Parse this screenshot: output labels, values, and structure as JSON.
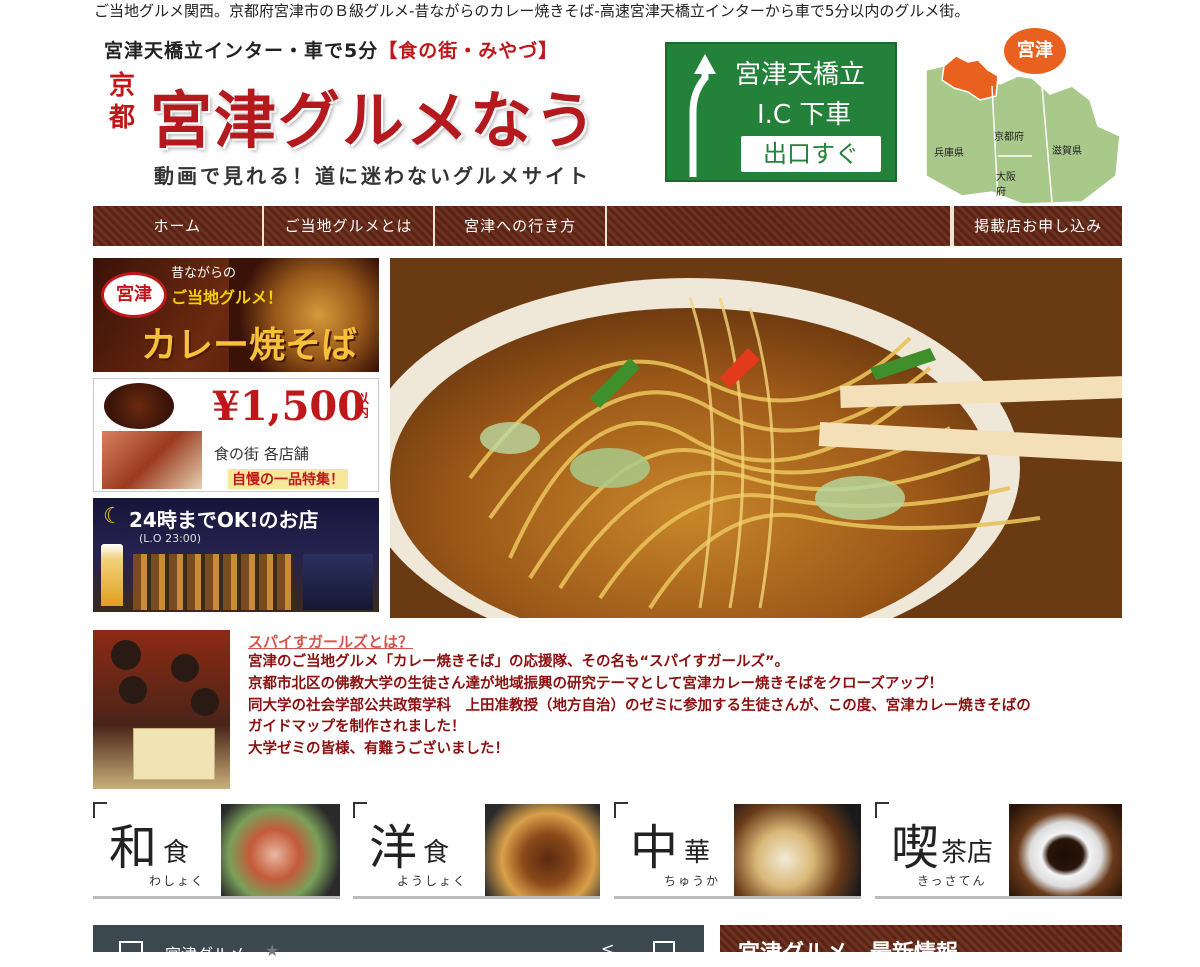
{
  "tagline": "ご当地グルメ関西。京都府宮津市のＢ級グルメ-昔ながらのカレー焼きそば-高速宮津天橋立インターから車で5分以内のグルメ街。",
  "header": {
    "top_line": "宮津天橋立インター・車で5分",
    "top_line_red": "【食の街・みやづ】",
    "kyoto": "京都",
    "title": "宮津グルメなう",
    "subtitle": "動画で見れる！道に迷わないグルメサイト"
  },
  "sign": {
    "line1": "宮津天橋立",
    "line2": "I.C 下車",
    "exit": "出口すぐ"
  },
  "map": {
    "badge": "宮津",
    "labels": [
      "兵庫県",
      "京都府",
      "滋賀県",
      "大阪府"
    ]
  },
  "nav": {
    "items": [
      "ホーム",
      "ご当地グルメとは",
      "宮津への行き方",
      "",
      "掲載店お申し込み"
    ]
  },
  "banners": {
    "b1": {
      "tag": "宮津",
      "l1": "昔ながらの",
      "l2": "ご当地グルメ！",
      "l3": "カレー焼そば"
    },
    "b2": {
      "price": "¥1,500",
      "suffix": "以内",
      "l1": "食の街 各店舗",
      "l2": "自慢の一品特集！"
    },
    "b3": {
      "l1": "24時までOK!のお店",
      "l2": "(L.O 23:00)"
    }
  },
  "spicy": {
    "link": "スパイすガールズとは？",
    "lines": [
      "宮津のご当地グルメ「カレー焼きそば」の応援隊、その名も“スパイすガールズ”。",
      "京都市北区の佛教大学の生徒さん達が地域振興の研究テーマとして宮津カレー焼きそばをクローズアップ！",
      "同大学の社会学部公共政策学科　上田准教授（地方自治）のゼミに参加する生徒さんが、この度、宮津カレー焼きそばの",
      "ガイドマップを制作されました！",
      "大学ゼミの皆様、有難うございました！"
    ]
  },
  "categories": [
    {
      "big": "和",
      "small": "食",
      "kana": "わしょく"
    },
    {
      "big": "洋",
      "small": "食",
      "kana": "ようしょく"
    },
    {
      "big": "中",
      "small": "華",
      "kana": "ちゅうか"
    },
    {
      "big": "喫",
      "small": "茶店",
      "kana": "きっさてん"
    }
  ],
  "widgets": {
    "left_title": "宮津グルメ",
    "right_title": "宮津グルメ　最新情報"
  }
}
